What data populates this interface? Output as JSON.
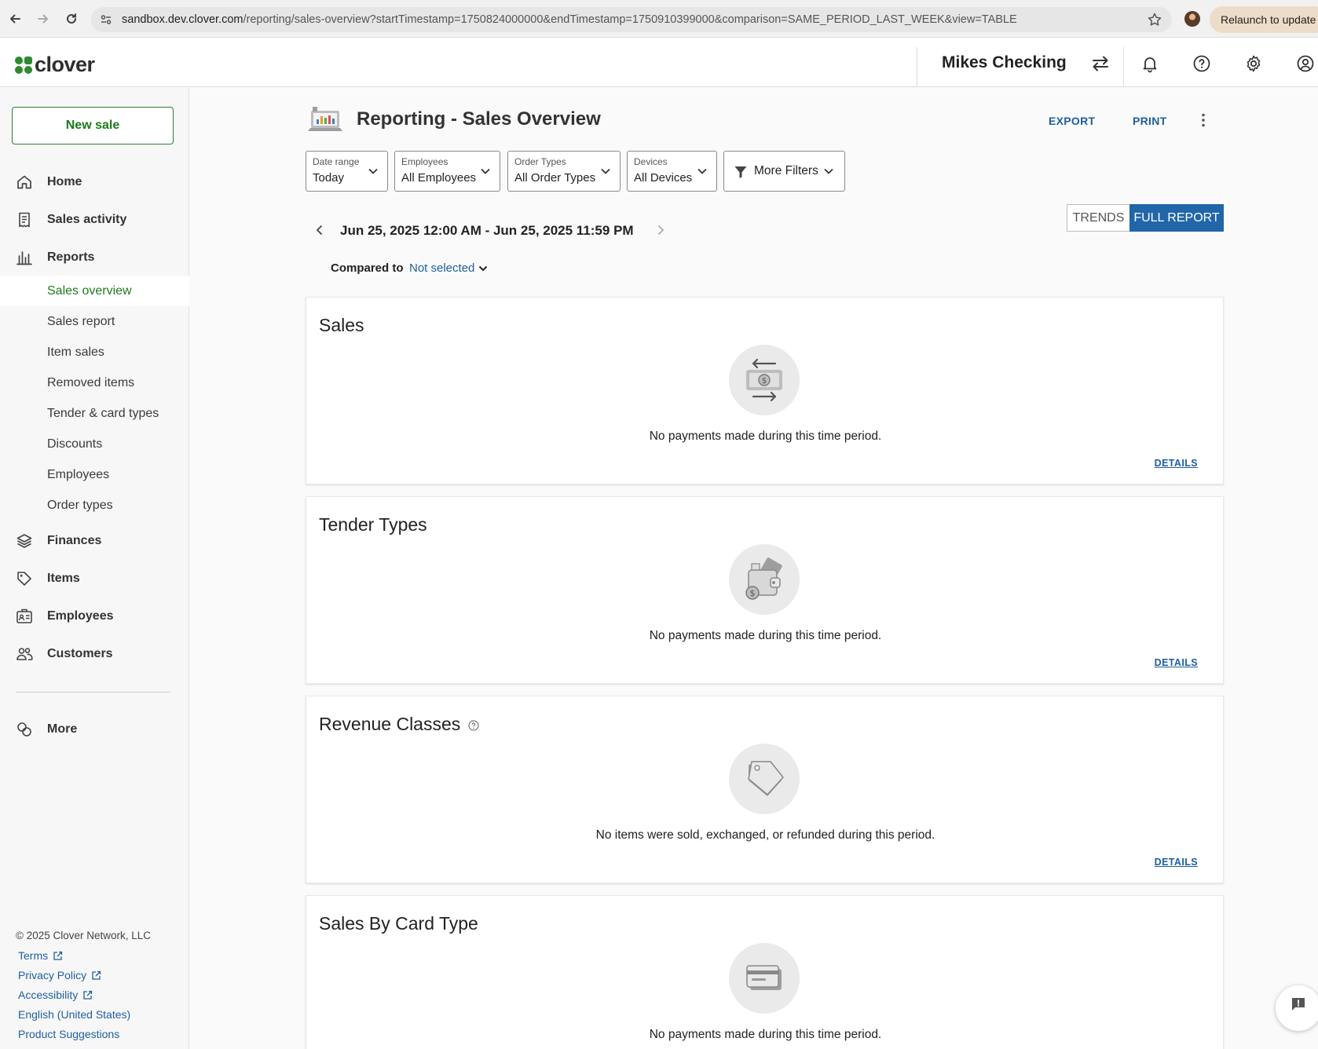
{
  "browser": {
    "url_host": "sandbox.dev.clover.com",
    "url_path": "/reporting/sales-overview?startTimestamp=1750824000000&endTimestamp=1750910399000&comparison=SAME_PERIOD_LAST_WEEK&view=TABLE",
    "relaunch_label": "Relaunch to update"
  },
  "header": {
    "logo_text": "clover",
    "merchant_name": "Mikes Checking"
  },
  "sidebar": {
    "new_sale_label": "New sale",
    "items": [
      {
        "label": "Home",
        "icon": "home-icon"
      },
      {
        "label": "Sales activity",
        "icon": "receipt-icon"
      },
      {
        "label": "Reports",
        "icon": "bar-chart-icon"
      },
      {
        "label": "Finances",
        "icon": "layers-icon"
      },
      {
        "label": "Items",
        "icon": "tag-icon"
      },
      {
        "label": "Employees",
        "icon": "id-card-icon"
      },
      {
        "label": "Customers",
        "icon": "people-icon"
      },
      {
        "label": "More",
        "icon": "more-apps-icon"
      }
    ],
    "report_subitems": [
      {
        "label": "Sales overview",
        "active": true
      },
      {
        "label": "Sales report"
      },
      {
        "label": "Item sales"
      },
      {
        "label": "Removed items"
      },
      {
        "label": "Tender & card types"
      },
      {
        "label": "Discounts"
      },
      {
        "label": "Employees"
      },
      {
        "label": "Order types"
      }
    ],
    "footer": {
      "copyright": "© 2025 Clover Network, LLC",
      "links": [
        "Terms",
        "Privacy Policy",
        "Accessibility",
        "English (United States)",
        "Product Suggestions"
      ]
    }
  },
  "main": {
    "title": "Reporting - Sales Overview",
    "export_label": "EXPORT",
    "print_label": "PRINT",
    "filters": [
      {
        "label": "Date range",
        "value": "Today"
      },
      {
        "label": "Employees",
        "value": "All Employees"
      },
      {
        "label": "Order Types",
        "value": "All Order Types"
      },
      {
        "label": "Devices",
        "value": "All Devices"
      }
    ],
    "more_filters_label": "More Filters",
    "view_toggle": {
      "trends": "TRENDS",
      "full_report": "FULL REPORT",
      "selected": "FULL REPORT"
    },
    "date_range": "Jun 25, 2025 12:00 AM - Jun 25, 2025 11:59 PM",
    "compared_to_label": "Compared to",
    "compared_to_value": "Not selected",
    "cards": [
      {
        "title": "Sales",
        "message": "No payments made during this time period.",
        "details": "DETAILS",
        "icon": "money-exchange-icon"
      },
      {
        "title": "Tender Types",
        "message": "No payments made during this time period.",
        "details": "DETAILS",
        "icon": "wallet-icon"
      },
      {
        "title": "Revenue Classes",
        "message": "No items were sold, exchanged, or refunded during this period.",
        "details": "DETAILS",
        "icon": "price-tag-icon"
      },
      {
        "title": "Sales By Card Type",
        "message": "No payments made during this time period.",
        "icon": "credit-card-icon"
      }
    ]
  },
  "colors": {
    "brand_green": "#1b7a1b",
    "link_blue": "#1f5f9f",
    "toggle_active": "#2166a8"
  }
}
